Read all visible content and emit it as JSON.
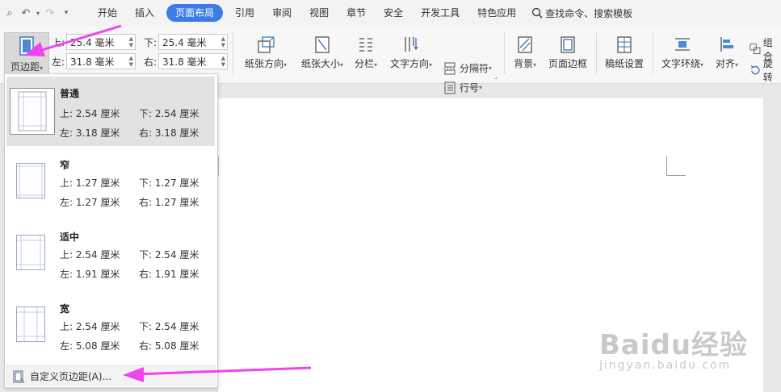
{
  "menu": {
    "tabs": [
      "开始",
      "插入",
      "页面布局",
      "引用",
      "审阅",
      "视图",
      "章节",
      "安全",
      "开发工具",
      "特色应用"
    ],
    "active_tab": "页面布局",
    "search_label": "查找命令、搜索模板"
  },
  "ribbon": {
    "margin_button": "页边距",
    "top_label": "上:",
    "top_value": "25.4 毫米",
    "bottom_label": "下:",
    "bottom_value": "25.4 毫米",
    "left_label": "左:",
    "left_value": "31.8 毫米",
    "right_label": "右:",
    "right_value": "31.8 毫米",
    "orientation": "纸张方向",
    "size": "纸张大小",
    "columns": "分栏",
    "text_direction": "文字方向",
    "breaks": "分隔符",
    "line_numbers": "行号",
    "background": "背景",
    "page_border": "页面边框",
    "manuscript": "稿纸设置",
    "text_wrap": "文字环绕",
    "align": "对齐",
    "group": "组合",
    "rotate": "旋转"
  },
  "dropdown": {
    "options": [
      {
        "name": "普通",
        "top": "上: 2.54 厘米",
        "bottom": "下: 2.54 厘米",
        "left": "左: 3.18 厘米",
        "right": "右: 3.18 厘米"
      },
      {
        "name": "窄",
        "top": "上: 1.27 厘米",
        "bottom": "下: 1.27 厘米",
        "left": "左: 1.27 厘米",
        "right": "右: 1.27 厘米"
      },
      {
        "name": "适中",
        "top": "上: 2.54 厘米",
        "bottom": "下: 2.54 厘米",
        "left": "左: 1.91 厘米",
        "right": "右: 1.91 厘米"
      },
      {
        "name": "宽",
        "top": "上: 2.54 厘米",
        "bottom": "下: 2.54 厘米",
        "left": "左: 5.08 厘米",
        "right": "右: 5.08 厘米"
      }
    ],
    "custom": "自定义页边距(A)..."
  },
  "watermark": {
    "brand": "Baidu经验",
    "url": "jingyan.baidu.com"
  },
  "colors": {
    "accent": "#3b7ce6",
    "annotation_arrow": "#ee44ee"
  }
}
